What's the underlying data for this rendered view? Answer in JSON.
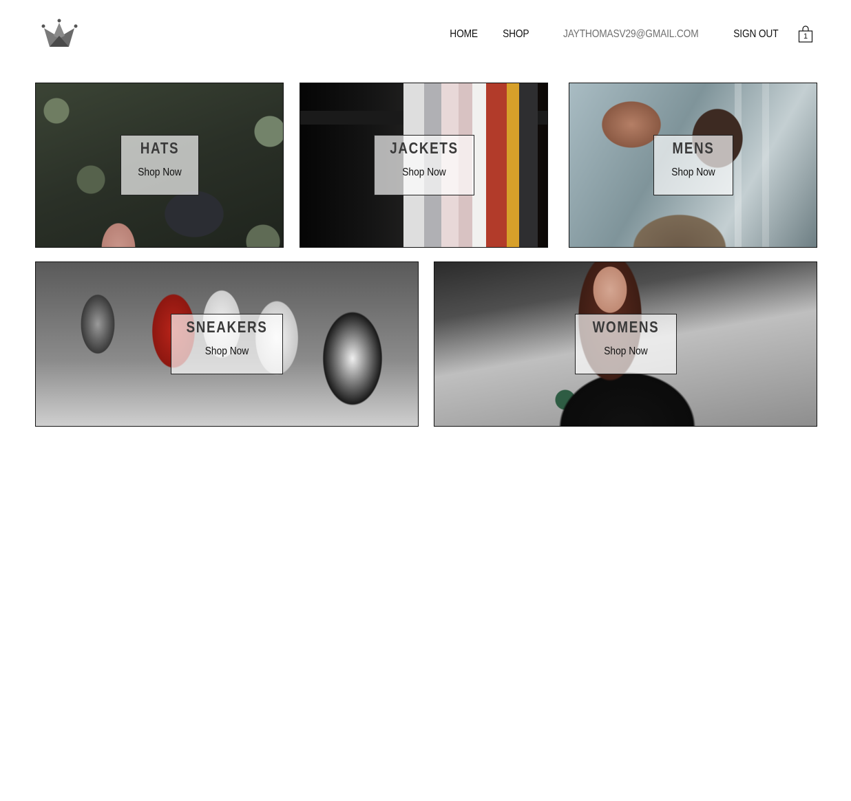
{
  "header": {
    "logo_icon": "crown-icon",
    "nav": {
      "home": "HOME",
      "shop": "SHOP",
      "user_email": "JAYTHOMASV29@GMAIL.COM",
      "sign_out": "SIGN OUT"
    },
    "cart": {
      "icon": "shopping-bag-icon",
      "count": "1"
    }
  },
  "directory": {
    "items": [
      {
        "title": "HATS",
        "cta": "Shop Now"
      },
      {
        "title": "JACKETS",
        "cta": "Shop Now"
      },
      {
        "title": "MENS",
        "cta": "Shop Now"
      },
      {
        "title": "SNEAKERS",
        "cta": "Shop Now"
      },
      {
        "title": "WOMENS",
        "cta": "Shop Now"
      }
    ]
  },
  "colors": {
    "text": "#111111",
    "user_email_text": "#707070",
    "panel_background": "rgba(255,255,255,0.68)",
    "tile_border": "#111111"
  }
}
